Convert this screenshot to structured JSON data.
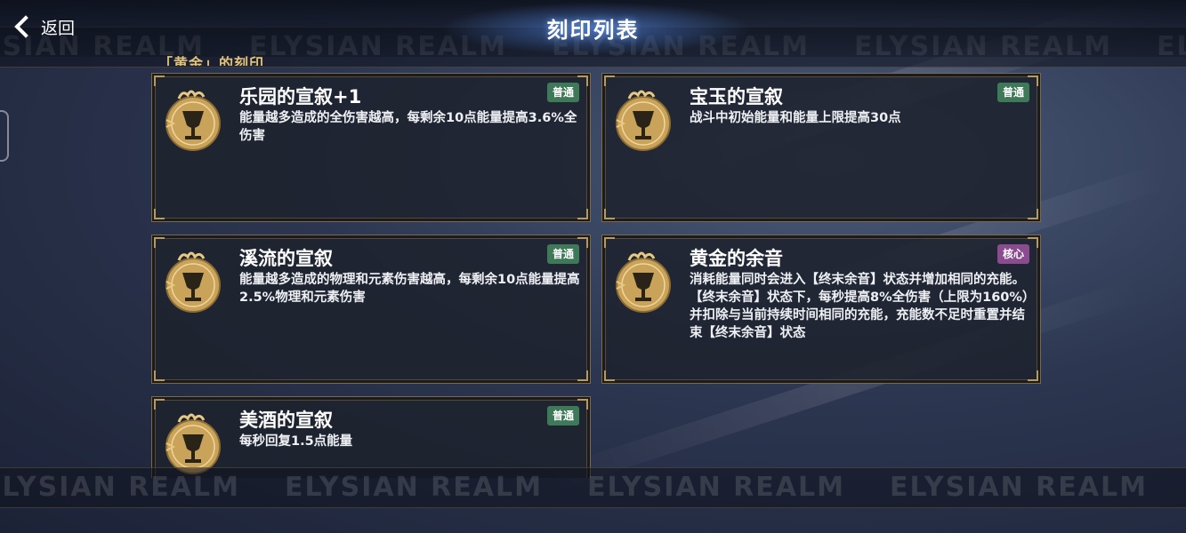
{
  "header": {
    "back_label": "返回",
    "title": "刻印列表"
  },
  "section_label": "「黄金」的刻印",
  "watermark_text": "ELYSIAN REALM",
  "cards": [
    {
      "name": "乐园的宣叙+1",
      "tag": "普通",
      "tag_type": "normal",
      "description": "能量越多造成的全伤害越高，每剩余10点能量提高3.6%全伤害"
    },
    {
      "name": "宝玉的宣叙",
      "tag": "普通",
      "tag_type": "normal",
      "description": "战斗中初始能量和能量上限提高30点"
    },
    {
      "name": "溪流的宣叙",
      "tag": "普通",
      "tag_type": "normal",
      "description": "能量越多造成的物理和元素伤害越高，每剩余10点能量提高2.5%物理和元素伤害"
    },
    {
      "name": "黄金的余音",
      "tag": "核心",
      "tag_type": "core",
      "description": "消耗能量同时会进入【终末余音】状态并增加相同的充能。【终末余音】状态下，每秒提高8%全伤害（上限为160%）并扣除与当前持续时间相同的充能，充能数不足时重置并结束【终末余音】状态"
    },
    {
      "name": "美酒的宣叙",
      "tag": "普通",
      "tag_type": "normal",
      "description": "每秒回复1.5点能量"
    }
  ],
  "colors": {
    "tag_normal": "#3f7a58",
    "tag_core": "#8a4c8e",
    "gold": "#c9a35a"
  },
  "icons": {
    "card_emblem": "golden-chalice-emblem-icon",
    "back": "chevron-left-icon"
  }
}
